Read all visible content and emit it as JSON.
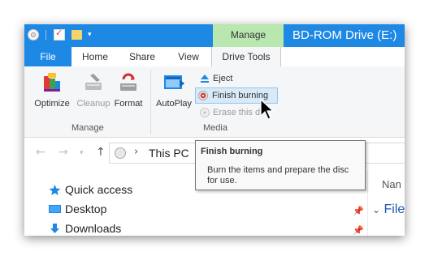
{
  "window": {
    "title": "BD-ROM Drive (E:)",
    "contextual_tab_group": "Manage"
  },
  "quick_access_toolbar": {
    "icons": [
      "disc-icon",
      "properties-icon",
      "new-folder-icon",
      "customize-dropdown-icon"
    ]
  },
  "tabs": [
    {
      "label": "File"
    },
    {
      "label": "Home"
    },
    {
      "label": "Share"
    },
    {
      "label": "View"
    },
    {
      "label": "Drive Tools"
    }
  ],
  "ribbon": {
    "groups": {
      "manage": {
        "label": "Manage",
        "buttons": [
          {
            "label": "Optimize",
            "icon": "optimize-icon",
            "enabled": true
          },
          {
            "label": "Cleanup",
            "icon": "cleanup-icon",
            "enabled": false
          },
          {
            "label": "Format",
            "icon": "format-icon",
            "enabled": true
          }
        ]
      },
      "media": {
        "label": "Media",
        "autoplay": {
          "label": "AutoPlay",
          "icon": "autoplay-icon"
        },
        "small_buttons": [
          {
            "label": "Eject",
            "icon": "eject-icon",
            "enabled": true
          },
          {
            "label": "Finish burning",
            "icon": "finish-burning-icon",
            "enabled": true,
            "hovered": true
          },
          {
            "label": "Erase this d",
            "icon": "erase-disc-icon",
            "enabled": false
          }
        ]
      }
    }
  },
  "address_bar": {
    "location": "This PC",
    "separator": "›"
  },
  "navigation_pane": {
    "items": [
      {
        "label": "Quick access",
        "icon": "star-icon"
      },
      {
        "label": "Desktop",
        "icon": "desktop-icon",
        "pinned": true
      },
      {
        "label": "Downloads",
        "icon": "download-icon",
        "pinned": true
      }
    ]
  },
  "file_list": {
    "column_header": "Nan",
    "group_header": "File"
  },
  "tooltip": {
    "title": "Finish burning",
    "body": "Burn the items and prepare the disc for use."
  },
  "colors": {
    "title_bar": "#1e88e5",
    "manage_tab": "#b9e7b0",
    "ribbon_bg": "#f5f6f7",
    "hover_highlight": "#d8e9f8"
  }
}
